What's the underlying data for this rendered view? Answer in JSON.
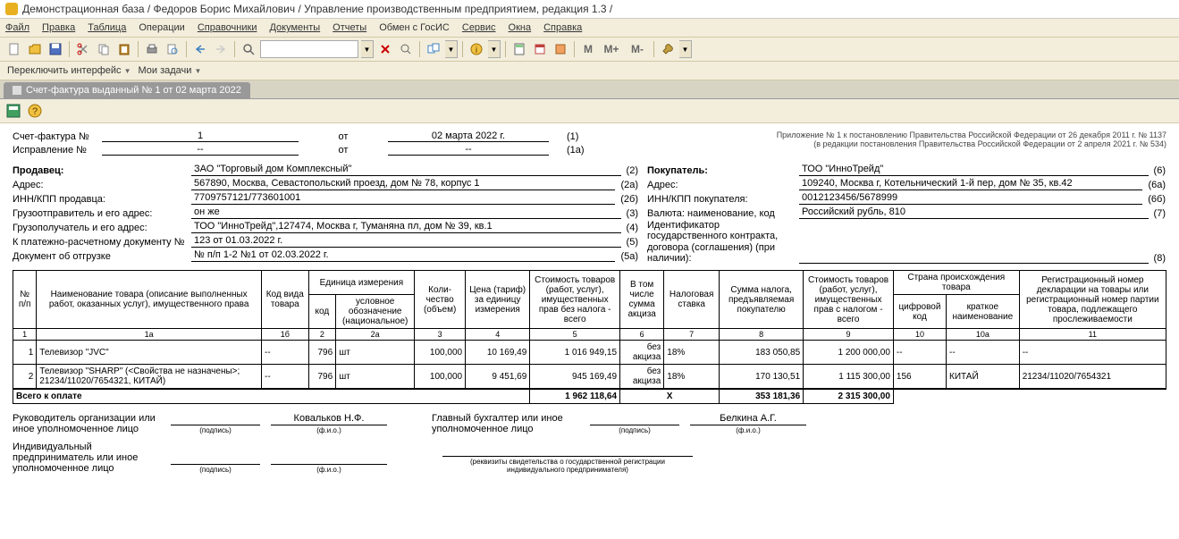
{
  "title": "Демонстрационная база / Федоров Борис Михайлович / Управление производственным предприятием, редакция 1.3 /",
  "menu": [
    "Файл",
    "Правка",
    "Таблица",
    "Операции",
    "Справочники",
    "Документы",
    "Отчеты",
    "Обмен с ГосИС",
    "Сервис",
    "Окна",
    "Справка"
  ],
  "secondary": {
    "switch_if": "Переключить интерфейс",
    "my_tasks": "Мои задачи"
  },
  "toolbar_m": {
    "m": "M",
    "mp": "M+",
    "mm": "M-"
  },
  "tab": {
    "title": "Счет-фактура выданный № 1 от 02 марта 2022"
  },
  "header": {
    "inv_lbl": "Счет-фактура №",
    "inv_no": "1",
    "from_lbl": "от",
    "inv_date": "02 марта 2022 г.",
    "num1": "(1)",
    "corr_lbl": "Исправление №",
    "corr_no": "--",
    "corr_date": "--",
    "num1a": "(1а)",
    "appendix1": "Приложение № 1 к постановлению Правительства Российской Федерации от 26 декабря 2011 г. № 1137",
    "appendix2": "(в редакции постановления Правительства Российской Федерации от 2 апреля 2021 г. № 534)"
  },
  "fields_left": [
    {
      "l": "Продавец:",
      "v": "ЗАО \"Торговый дом Комплексный\"",
      "n": "(2)",
      "bold": true
    },
    {
      "l": "Адрес:",
      "v": "567890, Москва, Севастопольский проезд, дом № 78, корпус 1",
      "n": "(2а)"
    },
    {
      "l": "ИНН/КПП продавца:",
      "v": "7709757121/773601001",
      "n": "(2б)"
    },
    {
      "l": "Грузоотправитель и его адрес:",
      "v": "он же",
      "n": "(3)"
    },
    {
      "l": "Грузополучатель и его адрес:",
      "v": "ТОО \"ИнноТрейд\",127474, Москва г, Туманяна пл, дом № 39, кв.1",
      "n": "(4)"
    },
    {
      "l": "К платежно-расчетному документу №",
      "v": "123 от 01.03.2022 г.",
      "n": "(5)"
    },
    {
      "l": "Документ об отгрузке",
      "v": "№ п/п 1-2 №1 от 02.03.2022 г.",
      "n": "(5а)"
    }
  ],
  "fields_right": [
    {
      "l": "Покупатель:",
      "v": "ТОО \"ИнноТрейд\"",
      "n": "(6)",
      "bold": true
    },
    {
      "l": "Адрес:",
      "v": "109240, Москва г, Котельнический 1-й пер, дом № 35, кв.42",
      "n": "(6а)"
    },
    {
      "l": "ИНН/КПП покупателя:",
      "v": "0012123456/5678999",
      "n": "(6б)"
    },
    {
      "l": "Валюта: наименование, код",
      "v": "Российский рубль, 810",
      "n": "(7)"
    },
    {
      "l": "Идентификатор государственного контракта,",
      "v": "",
      "nl": true
    },
    {
      "l": "договора (соглашения) (при наличии):",
      "v": "",
      "n": "(8)"
    }
  ],
  "table": {
    "headers": {
      "c1": "№ п/п",
      "c1a": "Наименование товара (описание выполненных работ, оказанных услуг), имущественного права",
      "c1b": "Код вида товара",
      "c2g": "Единица измерения",
      "c2": "код",
      "c2a": "условное обозначение (национальное)",
      "c3": "Коли-чество (объем)",
      "c4": "Цена (тариф) за единицу измерения",
      "c5": "Стоимость товаров (работ, услуг), имущественных прав без налога - всего",
      "c6": "В том числе сумма акциза",
      "c7": "Налоговая ставка",
      "c8": "Сумма налога, предъявляемая покупателю",
      "c9": "Стоимость товаров (работ, услуг), имущественных прав с налогом - всего",
      "c10g": "Страна происхождения товара",
      "c10": "цифровой код",
      "c10a": "краткое наименование",
      "c11": "Регистрационный номер декларации на товары или регистрационный номер партии товара, подлежащего прослеживаемости"
    },
    "numrow": [
      "1",
      "1а",
      "1б",
      "2",
      "2а",
      "3",
      "4",
      "5",
      "6",
      "7",
      "8",
      "9",
      "10",
      "10а",
      "11"
    ],
    "rows": [
      {
        "n": "1",
        "name": "Телевизор \"JVC\"",
        "kind": "--",
        "code": "796",
        "unit": "шт",
        "qty": "100,000",
        "price": "10 169,49",
        "sum_no_tax": "1 016 949,15",
        "excise": "без акциза",
        "rate": "18%",
        "tax": "183 050,85",
        "sum_tax": "1 200 000,00",
        "country_code": "--",
        "country": "--",
        "reg": "--"
      },
      {
        "n": "2",
        "name": "Телевизор \"SHARP\" (<Свойства не назначены>; 21234/11020/7654321, КИТАЙ)",
        "kind": "--",
        "code": "796",
        "unit": "шт",
        "qty": "100,000",
        "price": "9 451,69",
        "sum_no_tax": "945 169,49",
        "excise": "без акциза",
        "rate": "18%",
        "tax": "170 130,51",
        "sum_tax": "1 115 300,00",
        "country_code": "156",
        "country": "КИТАЙ",
        "reg": "21234/11020/7654321"
      }
    ],
    "total_lbl": "Всего к оплате",
    "total_no_tax": "1 962 118,64",
    "total_x": "X",
    "total_tax": "353 181,36",
    "total_with_tax": "2 315 300,00"
  },
  "sig": {
    "head_lbl": "Руководитель организации или иное уполномоченное лицо",
    "head_name": "Ковальков Н.Ф.",
    "acc_lbl": "Главный бухгалтер или иное уполномоченное лицо",
    "acc_name": "Белкина А.Г.",
    "ip_lbl": "Индивидуальный предприниматель или иное уполномоченное лицо",
    "sub_sign": "(подпись)",
    "sub_fio": "(ф.и.о.)",
    "sub_rekv": "(реквизиты свидетельства о государственной регистрации индивидуального предпринимателя)"
  }
}
